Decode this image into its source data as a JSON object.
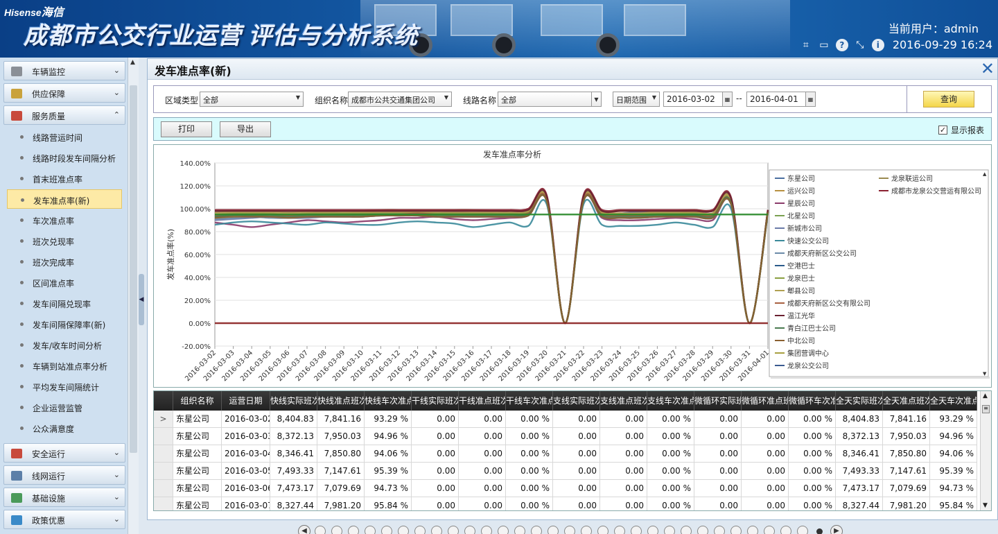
{
  "header": {
    "brand_en": "Hisense",
    "brand_cn": "海信",
    "system_title": "成都市公交行业运营 评估与分析系统",
    "current_user": "当前用户：admin",
    "datetime": "2016-09-29 16:24",
    "tool_icons": [
      "crop-icon",
      "window-icon",
      "help-icon",
      "fullscreen-icon",
      "info-icon"
    ]
  },
  "sidebar": {
    "groups_top": [
      {
        "label": "车辆监控",
        "icon": "camera-icon",
        "color": "#8a8f96"
      },
      {
        "label": "供应保障",
        "icon": "supply-icon",
        "color": "#c9a23c"
      },
      {
        "label": "服务质量",
        "icon": "service-icon",
        "color": "#c84a3c"
      }
    ],
    "items": [
      {
        "label": "线路营运时间"
      },
      {
        "label": "线路时段发车间隔分析"
      },
      {
        "label": "首末班准点率"
      },
      {
        "label": "发车准点率(新)"
      },
      {
        "label": "车次准点率"
      },
      {
        "label": "班次兑现率"
      },
      {
        "label": "班次完成率"
      },
      {
        "label": "区间准点率"
      },
      {
        "label": "发车间隔兑现率"
      },
      {
        "label": "发车间隔保障率(新)"
      },
      {
        "label": "发车/收车时间分析"
      },
      {
        "label": "车辆到站准点率分析"
      },
      {
        "label": "平均发车间隔统计"
      },
      {
        "label": "企业运营监管"
      },
      {
        "label": "公众满意度"
      }
    ],
    "active_index": 3,
    "groups_bottom": [
      {
        "label": "安全运行",
        "icon": "safety-icon",
        "color": "#c84a3c"
      },
      {
        "label": "线网运行",
        "icon": "network-icon",
        "color": "#5c7fa8"
      },
      {
        "label": "基础设施",
        "icon": "infrastructure-icon",
        "color": "#4a9a5a"
      },
      {
        "label": "政策优惠",
        "icon": "policy-icon",
        "color": "#3a8ac8"
      }
    ]
  },
  "panel": {
    "title": "发车准点率(新)"
  },
  "filters": {
    "region_type_label": "区域类型",
    "region_type_value": "全部",
    "org_label": "组织名称",
    "org_value": "成都市公共交通集团公司",
    "line_label": "线路名称",
    "line_value": "全部",
    "date_range_value": "日期范围",
    "date_from": "2016-03-02",
    "date_sep": "--",
    "date_to": "2016-04-01",
    "query_label": "查询"
  },
  "actions": {
    "print_label": "打印",
    "export_label": "导出",
    "show_report_label": "显示报表",
    "show_report_checked": "✓"
  },
  "chart_data": {
    "type": "line",
    "title": "发车准点率分析",
    "xlabel": "",
    "ylabel": "发车准点率(%)",
    "ylim": [
      -20,
      140
    ],
    "yticks": [
      "-20.00%",
      "0.00%",
      "20.00%",
      "40.00%",
      "60.00%",
      "80.00%",
      "100.00%",
      "120.00%",
      "140.00%"
    ],
    "categories": [
      "2016-03-02",
      "2016-03-03",
      "2016-03-04",
      "2016-03-05",
      "2016-03-06",
      "2016-03-07",
      "2016-03-08",
      "2016-03-09",
      "2016-03-10",
      "2016-03-11",
      "2016-03-12",
      "2016-03-13",
      "2016-03-14",
      "2016-03-15",
      "2016-03-16",
      "2016-03-17",
      "2016-03-18",
      "2016-03-19",
      "2016-03-20",
      "2016-03-21",
      "2016-03-22",
      "2016-03-23",
      "2016-03-24",
      "2016-03-25",
      "2016-03-26",
      "2016-03-27",
      "2016-03-28",
      "2016-03-29",
      "2016-03-30",
      "2016-03-31",
      "2016-04-01"
    ],
    "legend_position": "right",
    "series": [
      {
        "name": "东星公司",
        "color": "#4a6fa0",
        "values": [
          93,
          95,
          94,
          95,
          95,
          96,
          97,
          96,
          96,
          96,
          97,
          96,
          96,
          97,
          96,
          96,
          96,
          97,
          108,
          0,
          108,
          96,
          96,
          97,
          96,
          96,
          96,
          96,
          106,
          0,
          98
        ]
      },
      {
        "name": "龙泉联运公司",
        "color": "#9a8a50",
        "values": [
          97,
          98,
          98,
          98,
          97,
          98,
          98,
          98,
          98,
          99,
          99,
          99,
          99,
          99,
          99,
          98,
          98,
          99,
          110,
          0,
          110,
          98,
          98,
          98,
          98,
          98,
          99,
          98,
          108,
          0,
          99
        ]
      },
      {
        "name": "运兴公司",
        "color": "#b89040",
        "values": [
          95,
          96,
          96,
          96,
          95,
          96,
          96,
          96,
          97,
          97,
          97,
          97,
          96,
          96,
          96,
          96,
          96,
          97,
          109,
          0,
          109,
          97,
          96,
          96,
          96,
          96,
          97,
          96,
          107,
          0,
          98
        ]
      },
      {
        "name": "成都市龙泉公交营运有限公司",
        "color": "#8a2030",
        "values": [
          99,
          99,
          99,
          99,
          99,
          99,
          99,
          99,
          99,
          99,
          99,
          99,
          99,
          99,
          99,
          99,
          99,
          100,
          112,
          0,
          112,
          99,
          99,
          99,
          99,
          99,
          99,
          99,
          110,
          0,
          99
        ]
      },
      {
        "name": "星辰公司",
        "color": "#8a3a6a",
        "values": [
          88,
          86,
          84,
          86,
          88,
          90,
          89,
          88,
          89,
          90,
          92,
          92,
          93,
          91,
          90,
          91,
          92,
          94,
          107,
          0,
          107,
          92,
          90,
          90,
          91,
          92,
          91,
          90,
          105,
          0,
          97
        ]
      },
      {
        "name": "北星公司",
        "color": "#7aa050",
        "values": [
          92,
          94,
          95,
          95,
          96,
          95,
          95,
          96,
          96,
          96,
          96,
          97,
          96,
          95,
          95,
          95,
          95,
          96,
          108,
          0,
          109,
          96,
          95,
          95,
          96,
          96,
          95,
          94,
          106,
          0,
          98
        ]
      },
      {
        "name": "新城市公司",
        "color": "#6a7aa8",
        "values": [
          90,
          91,
          92,
          93,
          92,
          92,
          93,
          93,
          93,
          94,
          94,
          94,
          93,
          93,
          93,
          93,
          93,
          95,
          107,
          0,
          107,
          93,
          92,
          92,
          93,
          94,
          94,
          92,
          104,
          0,
          97
        ]
      },
      {
        "name": "快速公交公司",
        "color": "#3a8a9a",
        "values": [
          86,
          88,
          89,
          88,
          87,
          86,
          88,
          87,
          86,
          86,
          88,
          89,
          88,
          87,
          84,
          86,
          88,
          85,
          104,
          0,
          104,
          86,
          85,
          85,
          86,
          88,
          86,
          84,
          100,
          0,
          96
        ]
      },
      {
        "name": "成都天府新区公交公司",
        "color": "#6a8aa8",
        "values": [
          91,
          92,
          93,
          92,
          92,
          93,
          93,
          93,
          93,
          94,
          94,
          94,
          93,
          93,
          93,
          93,
          93,
          94,
          107,
          0,
          107,
          93,
          92,
          92,
          93,
          93,
          93,
          92,
          104,
          0,
          97
        ]
      },
      {
        "name": "空港巴士",
        "color": "#2a5a8a",
        "values": [
          94,
          95,
          95,
          95,
          94,
          95,
          95,
          95,
          95,
          96,
          96,
          96,
          95,
          95,
          95,
          95,
          95,
          96,
          108,
          0,
          108,
          95,
          94,
          94,
          95,
          95,
          95,
          94,
          106,
          0,
          98
        ]
      },
      {
        "name": "龙泉巴士",
        "color": "#8aa040",
        "values": [
          95,
          96,
          96,
          96,
          95,
          96,
          96,
          96,
          96,
          96,
          96,
          97,
          96,
          96,
          96,
          96,
          96,
          97,
          108,
          0,
          108,
          96,
          95,
          95,
          96,
          96,
          96,
          95,
          106,
          0,
          98
        ]
      },
      {
        "name": "郫县公司",
        "color": "#b0a050",
        "values": [
          96,
          97,
          97,
          97,
          96,
          97,
          97,
          97,
          97,
          97,
          97,
          97,
          97,
          97,
          97,
          97,
          97,
          98,
          109,
          0,
          109,
          97,
          96,
          96,
          97,
          97,
          97,
          96,
          107,
          0,
          98
        ]
      },
      {
        "name": "成都天府新区公交有限公司",
        "color": "#a86040",
        "values": [
          94,
          95,
          95,
          95,
          94,
          95,
          95,
          95,
          95,
          95,
          95,
          96,
          95,
          95,
          95,
          95,
          95,
          96,
          108,
          0,
          108,
          95,
          94,
          94,
          95,
          95,
          95,
          94,
          105,
          0,
          98
        ]
      },
      {
        "name": "温江光华",
        "color": "#6a2030",
        "values": [
          98,
          98,
          98,
          98,
          98,
          98,
          98,
          98,
          98,
          98,
          98,
          98,
          98,
          98,
          98,
          98,
          98,
          99,
          111,
          0,
          111,
          98,
          98,
          98,
          98,
          98,
          98,
          98,
          109,
          0,
          99
        ]
      },
      {
        "name": "青白江巴士公司",
        "color": "#4a7a50",
        "values": [
          93,
          94,
          94,
          94,
          93,
          94,
          94,
          94,
          94,
          95,
          95,
          95,
          94,
          94,
          94,
          94,
          94,
          95,
          107,
          0,
          107,
          94,
          93,
          93,
          94,
          94,
          94,
          93,
          105,
          0,
          97
        ]
      },
      {
        "name": "中北公司",
        "color": "#8a6030",
        "values": [
          92,
          93,
          93,
          93,
          92,
          93,
          93,
          93,
          93,
          94,
          94,
          94,
          93,
          93,
          93,
          93,
          93,
          94,
          107,
          0,
          107,
          93,
          92,
          92,
          93,
          93,
          93,
          92,
          104,
          0,
          97
        ]
      },
      {
        "name": "集团营调中心",
        "color": "#a8a040",
        "values": [
          95,
          95,
          95,
          95,
          95,
          95,
          95,
          95,
          95,
          95,
          95,
          95,
          95,
          95,
          95,
          95,
          95,
          95,
          95,
          95,
          95,
          95,
          95,
          95,
          95,
          95,
          95,
          95,
          95,
          95,
          95
        ]
      },
      {
        "name": "龙泉公交公司",
        "color": "#3a5a90",
        "values": [
          0,
          0,
          0,
          0,
          0,
          0,
          0,
          0,
          0,
          0,
          0,
          0,
          0,
          0,
          0,
          0,
          0,
          0,
          0,
          0,
          0,
          0,
          0,
          0,
          0,
          0,
          0,
          0,
          0,
          0,
          0
        ]
      }
    ]
  },
  "table": {
    "columns": [
      "组织名称",
      "运营日期",
      "快线实际班次",
      "快线准点班次",
      "快线车次准点率",
      "干线实际班次",
      "干线准点班次",
      "干线车次准点率",
      "支线实际班次",
      "支线准点班次",
      "支线车次准点率",
      "微循环实际班次",
      "微循环准点班次",
      "微循环车次准点率",
      "全天实际班次",
      "全天准点班次",
      "全天车次准点率"
    ],
    "rows": [
      [
        "东星公司",
        "2016-03-02",
        "8,404.83",
        "7,841.16",
        "93.29 %",
        "0.00",
        "0.00",
        "0.00 %",
        "0.00",
        "0.00",
        "0.00 %",
        "0.00",
        "0.00",
        "0.00 %",
        "8,404.83",
        "7,841.16",
        "93.29 %"
      ],
      [
        "东星公司",
        "2016-03-03",
        "8,372.13",
        "7,950.03",
        "94.96 %",
        "0.00",
        "0.00",
        "0.00 %",
        "0.00",
        "0.00",
        "0.00 %",
        "0.00",
        "0.00",
        "0.00 %",
        "8,372.13",
        "7,950.03",
        "94.96 %"
      ],
      [
        "东星公司",
        "2016-03-04",
        "8,346.41",
        "7,850.80",
        "94.06 %",
        "0.00",
        "0.00",
        "0.00 %",
        "0.00",
        "0.00",
        "0.00 %",
        "0.00",
        "0.00",
        "0.00 %",
        "8,346.41",
        "7,850.80",
        "94.06 %"
      ],
      [
        "东星公司",
        "2016-03-05",
        "7,493.33",
        "7,147.61",
        "95.39 %",
        "0.00",
        "0.00",
        "0.00 %",
        "0.00",
        "0.00",
        "0.00 %",
        "0.00",
        "0.00",
        "0.00 %",
        "7,493.33",
        "7,147.61",
        "95.39 %"
      ],
      [
        "东星公司",
        "2016-03-06",
        "7,473.17",
        "7,079.69",
        "94.73 %",
        "0.00",
        "0.00",
        "0.00 %",
        "0.00",
        "0.00",
        "0.00 %",
        "0.00",
        "0.00",
        "0.00 %",
        "7,473.17",
        "7,079.69",
        "94.73 %"
      ],
      [
        "东星公司",
        "2016-03-07",
        "8,327.44",
        "7,981.20",
        "95.84 %",
        "0.00",
        "0.00",
        "0.00 %",
        "0.00",
        "0.00",
        "0.00 %",
        "0.00",
        "0.00",
        "0.00 %",
        "8,327.44",
        "7,981.20",
        "95.84 %"
      ]
    ],
    "selected_marker": ">"
  },
  "pager": {
    "prev": "◀",
    "next": "▶"
  }
}
